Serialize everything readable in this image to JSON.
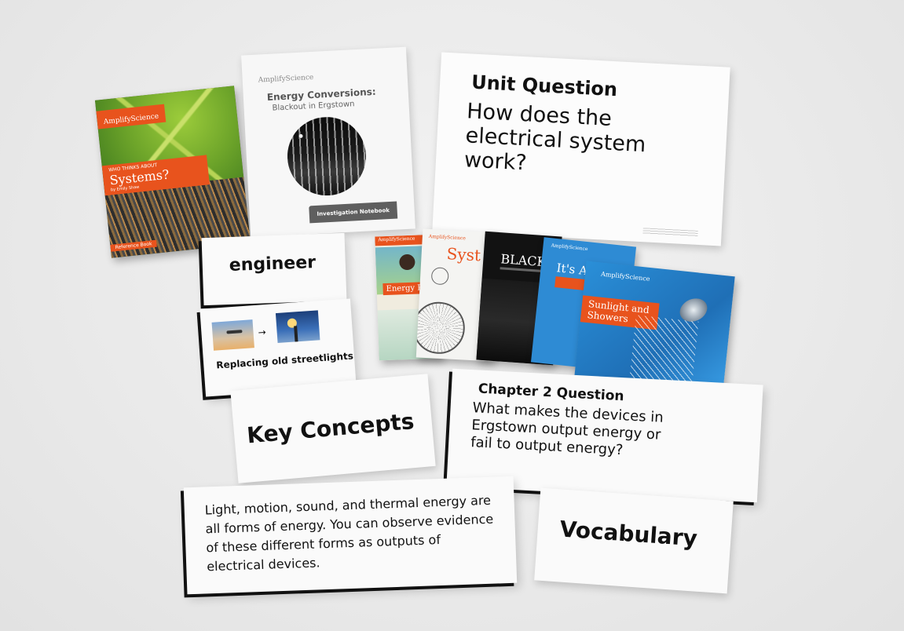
{
  "systems_book": {
    "brand": "AmplifyScience",
    "title_small": "WHO THINKS ABOUT",
    "title": "Systems?",
    "author": "by Emily Shaw",
    "footer": "Reference Book"
  },
  "notebook": {
    "brand": "AmplifyScience",
    "title": "Energy Conversions:",
    "subtitle": "Blackout in Ergstown",
    "label": "Investigation Notebook"
  },
  "unit_question": {
    "heading": "Unit Question",
    "text": "How does the electrical system work?"
  },
  "engineer_card": {
    "word": "engineer"
  },
  "streetlights_card": {
    "caption": "Replacing old streetlights"
  },
  "key_concepts_card": {
    "text": "Key Concepts"
  },
  "chapter_question": {
    "heading": "Chapter 2 Question",
    "text": "What makes the devices in Ergstown output energy or fail to output energy?"
  },
  "concept_card": {
    "text": "Light, motion, sound, and thermal energy are all forms of energy. You can observe evidence of these different forms as outputs of electrical devices."
  },
  "vocabulary_card": {
    "text": "Vocabulary"
  },
  "books": {
    "energy": {
      "brand": "AmplifyScience",
      "title": "Energy P"
    },
    "systems": {
      "brand": "AmplifyScience",
      "title": "Syst"
    },
    "blackout": {
      "title": "BLACK"
    },
    "its_all": {
      "brand": "AmplifyScience",
      "title": "It's Al"
    },
    "sunlight": {
      "brand": "AmplifyScience",
      "title": "Sunlight and Showers"
    }
  },
  "colors": {
    "amplify_orange": "#e8531d",
    "blue_book": "#2e8bd4",
    "black": "#111111"
  }
}
